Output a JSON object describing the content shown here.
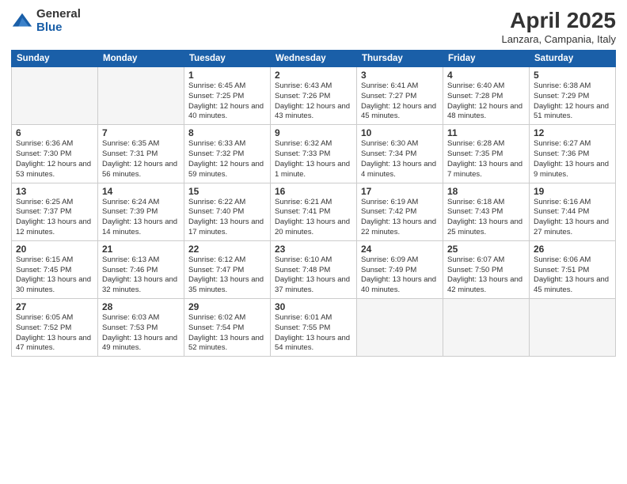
{
  "logo": {
    "general": "General",
    "blue": "Blue"
  },
  "title": "April 2025",
  "location": "Lanzara, Campania, Italy",
  "days_of_week": [
    "Sunday",
    "Monday",
    "Tuesday",
    "Wednesday",
    "Thursday",
    "Friday",
    "Saturday"
  ],
  "weeks": [
    [
      {
        "day": "",
        "info": ""
      },
      {
        "day": "",
        "info": ""
      },
      {
        "day": "1",
        "info": "Sunrise: 6:45 AM\nSunset: 7:25 PM\nDaylight: 12 hours and 40 minutes."
      },
      {
        "day": "2",
        "info": "Sunrise: 6:43 AM\nSunset: 7:26 PM\nDaylight: 12 hours and 43 minutes."
      },
      {
        "day": "3",
        "info": "Sunrise: 6:41 AM\nSunset: 7:27 PM\nDaylight: 12 hours and 45 minutes."
      },
      {
        "day": "4",
        "info": "Sunrise: 6:40 AM\nSunset: 7:28 PM\nDaylight: 12 hours and 48 minutes."
      },
      {
        "day": "5",
        "info": "Sunrise: 6:38 AM\nSunset: 7:29 PM\nDaylight: 12 hours and 51 minutes."
      }
    ],
    [
      {
        "day": "6",
        "info": "Sunrise: 6:36 AM\nSunset: 7:30 PM\nDaylight: 12 hours and 53 minutes."
      },
      {
        "day": "7",
        "info": "Sunrise: 6:35 AM\nSunset: 7:31 PM\nDaylight: 12 hours and 56 minutes."
      },
      {
        "day": "8",
        "info": "Sunrise: 6:33 AM\nSunset: 7:32 PM\nDaylight: 12 hours and 59 minutes."
      },
      {
        "day": "9",
        "info": "Sunrise: 6:32 AM\nSunset: 7:33 PM\nDaylight: 13 hours and 1 minute."
      },
      {
        "day": "10",
        "info": "Sunrise: 6:30 AM\nSunset: 7:34 PM\nDaylight: 13 hours and 4 minutes."
      },
      {
        "day": "11",
        "info": "Sunrise: 6:28 AM\nSunset: 7:35 PM\nDaylight: 13 hours and 7 minutes."
      },
      {
        "day": "12",
        "info": "Sunrise: 6:27 AM\nSunset: 7:36 PM\nDaylight: 13 hours and 9 minutes."
      }
    ],
    [
      {
        "day": "13",
        "info": "Sunrise: 6:25 AM\nSunset: 7:37 PM\nDaylight: 13 hours and 12 minutes."
      },
      {
        "day": "14",
        "info": "Sunrise: 6:24 AM\nSunset: 7:39 PM\nDaylight: 13 hours and 14 minutes."
      },
      {
        "day": "15",
        "info": "Sunrise: 6:22 AM\nSunset: 7:40 PM\nDaylight: 13 hours and 17 minutes."
      },
      {
        "day": "16",
        "info": "Sunrise: 6:21 AM\nSunset: 7:41 PM\nDaylight: 13 hours and 20 minutes."
      },
      {
        "day": "17",
        "info": "Sunrise: 6:19 AM\nSunset: 7:42 PM\nDaylight: 13 hours and 22 minutes."
      },
      {
        "day": "18",
        "info": "Sunrise: 6:18 AM\nSunset: 7:43 PM\nDaylight: 13 hours and 25 minutes."
      },
      {
        "day": "19",
        "info": "Sunrise: 6:16 AM\nSunset: 7:44 PM\nDaylight: 13 hours and 27 minutes."
      }
    ],
    [
      {
        "day": "20",
        "info": "Sunrise: 6:15 AM\nSunset: 7:45 PM\nDaylight: 13 hours and 30 minutes."
      },
      {
        "day": "21",
        "info": "Sunrise: 6:13 AM\nSunset: 7:46 PM\nDaylight: 13 hours and 32 minutes."
      },
      {
        "day": "22",
        "info": "Sunrise: 6:12 AM\nSunset: 7:47 PM\nDaylight: 13 hours and 35 minutes."
      },
      {
        "day": "23",
        "info": "Sunrise: 6:10 AM\nSunset: 7:48 PM\nDaylight: 13 hours and 37 minutes."
      },
      {
        "day": "24",
        "info": "Sunrise: 6:09 AM\nSunset: 7:49 PM\nDaylight: 13 hours and 40 minutes."
      },
      {
        "day": "25",
        "info": "Sunrise: 6:07 AM\nSunset: 7:50 PM\nDaylight: 13 hours and 42 minutes."
      },
      {
        "day": "26",
        "info": "Sunrise: 6:06 AM\nSunset: 7:51 PM\nDaylight: 13 hours and 45 minutes."
      }
    ],
    [
      {
        "day": "27",
        "info": "Sunrise: 6:05 AM\nSunset: 7:52 PM\nDaylight: 13 hours and 47 minutes."
      },
      {
        "day": "28",
        "info": "Sunrise: 6:03 AM\nSunset: 7:53 PM\nDaylight: 13 hours and 49 minutes."
      },
      {
        "day": "29",
        "info": "Sunrise: 6:02 AM\nSunset: 7:54 PM\nDaylight: 13 hours and 52 minutes."
      },
      {
        "day": "30",
        "info": "Sunrise: 6:01 AM\nSunset: 7:55 PM\nDaylight: 13 hours and 54 minutes."
      },
      {
        "day": "",
        "info": ""
      },
      {
        "day": "",
        "info": ""
      },
      {
        "day": "",
        "info": ""
      }
    ]
  ]
}
